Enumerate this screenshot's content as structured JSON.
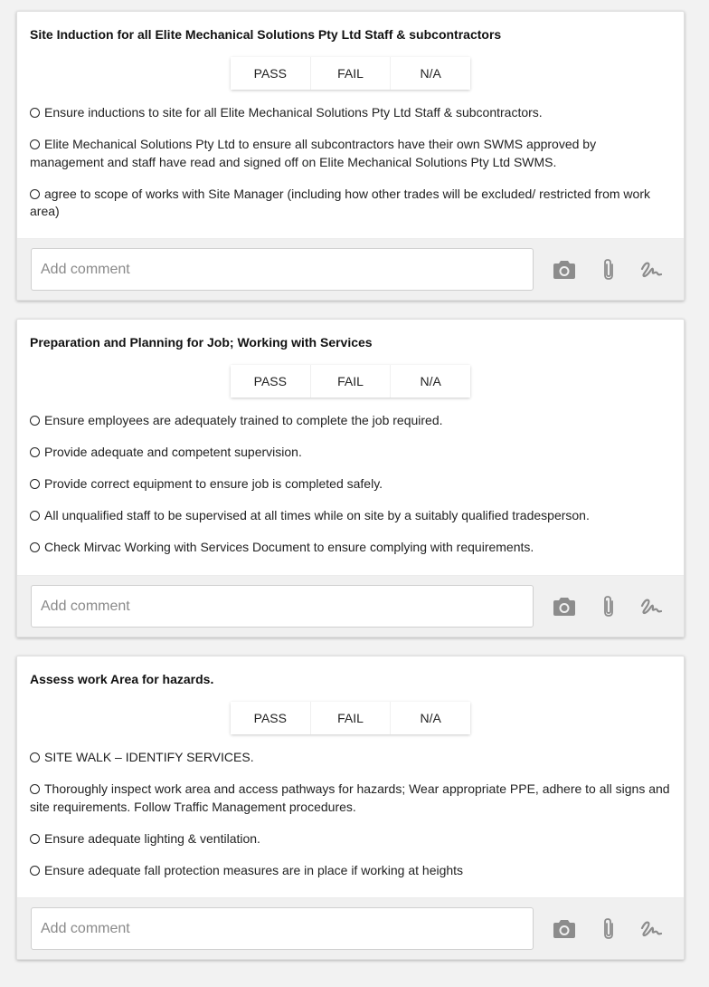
{
  "options": {
    "pass": "PASS",
    "fail": "FAIL",
    "na": "N/A"
  },
  "comment_placeholder": "Add comment",
  "icons": [
    "camera-icon",
    "paperclip-icon",
    "signature-icon"
  ],
  "sections": [
    {
      "title": "Site Induction for all Elite Mechanical Solutions Pty Ltd Staff & subcontractors",
      "items": [
        "Ensure inductions to site for all Elite Mechanical Solutions Pty Ltd Staff & subcontractors.",
        "Elite Mechanical Solutions Pty Ltd to ensure all subcontractors have their own SWMS approved by management and staff have read and signed off on Elite Mechanical Solutions Pty Ltd SWMS.",
        "agree to scope of works with Site Manager (including how other trades will be excluded/ restricted from work area)"
      ]
    },
    {
      "title": "Preparation and Planning for Job; Working with Services",
      "items": [
        "Ensure employees are adequately trained to complete the job required.",
        "Provide adequate and competent supervision.",
        "Provide correct equipment to ensure job is completed safely.",
        "All unqualified staff to be supervised at all times while on site by a suitably qualified tradesperson.",
        "Check Mirvac Working with Services Document to ensure complying with requirements."
      ]
    },
    {
      "title": "Assess work Area for hazards.",
      "items": [
        "SITE WALK – IDENTIFY SERVICES.",
        "Thoroughly inspect work area and access pathways for hazards; Wear appropriate PPE, adhere to all signs and site requirements. Follow Traffic Management procedures.",
        "Ensure adequate lighting & ventilation.",
        "Ensure adequate fall protection measures are in place if working at heights"
      ]
    }
  ]
}
